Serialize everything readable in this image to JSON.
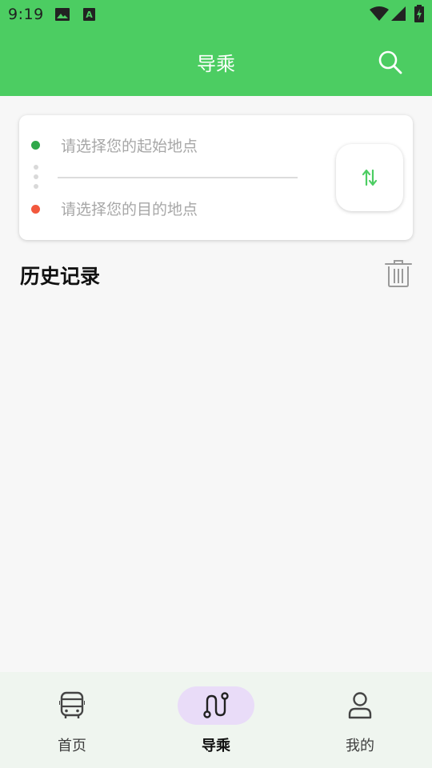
{
  "status_bar": {
    "time": "9:19",
    "icons": [
      "image-icon",
      "text-notification-icon",
      "wifi-icon",
      "signal-icon",
      "battery-charging-icon"
    ]
  },
  "header": {
    "title": "导乘",
    "search_icon": "search-icon"
  },
  "route": {
    "start_placeholder": "请选择您的起始地点",
    "end_placeholder": "请选择您的目的地点",
    "swap_icon": "swap-vertical-icon",
    "start_dot_color": "#2fa84a",
    "end_dot_color": "#f2583d"
  },
  "history": {
    "title": "历史记录",
    "clear_icon": "trash-icon"
  },
  "bottom_nav": {
    "items": [
      {
        "label": "首页",
        "icon": "bus-icon",
        "active": false
      },
      {
        "label": "导乘",
        "icon": "route-icon",
        "active": true
      },
      {
        "label": "我的",
        "icon": "person-icon",
        "active": false
      }
    ]
  },
  "colors": {
    "brand_green": "#4ccd62",
    "active_pill": "#e9dcf8",
    "background": "#f7f7f7",
    "nav_background": "#eff5ef"
  }
}
